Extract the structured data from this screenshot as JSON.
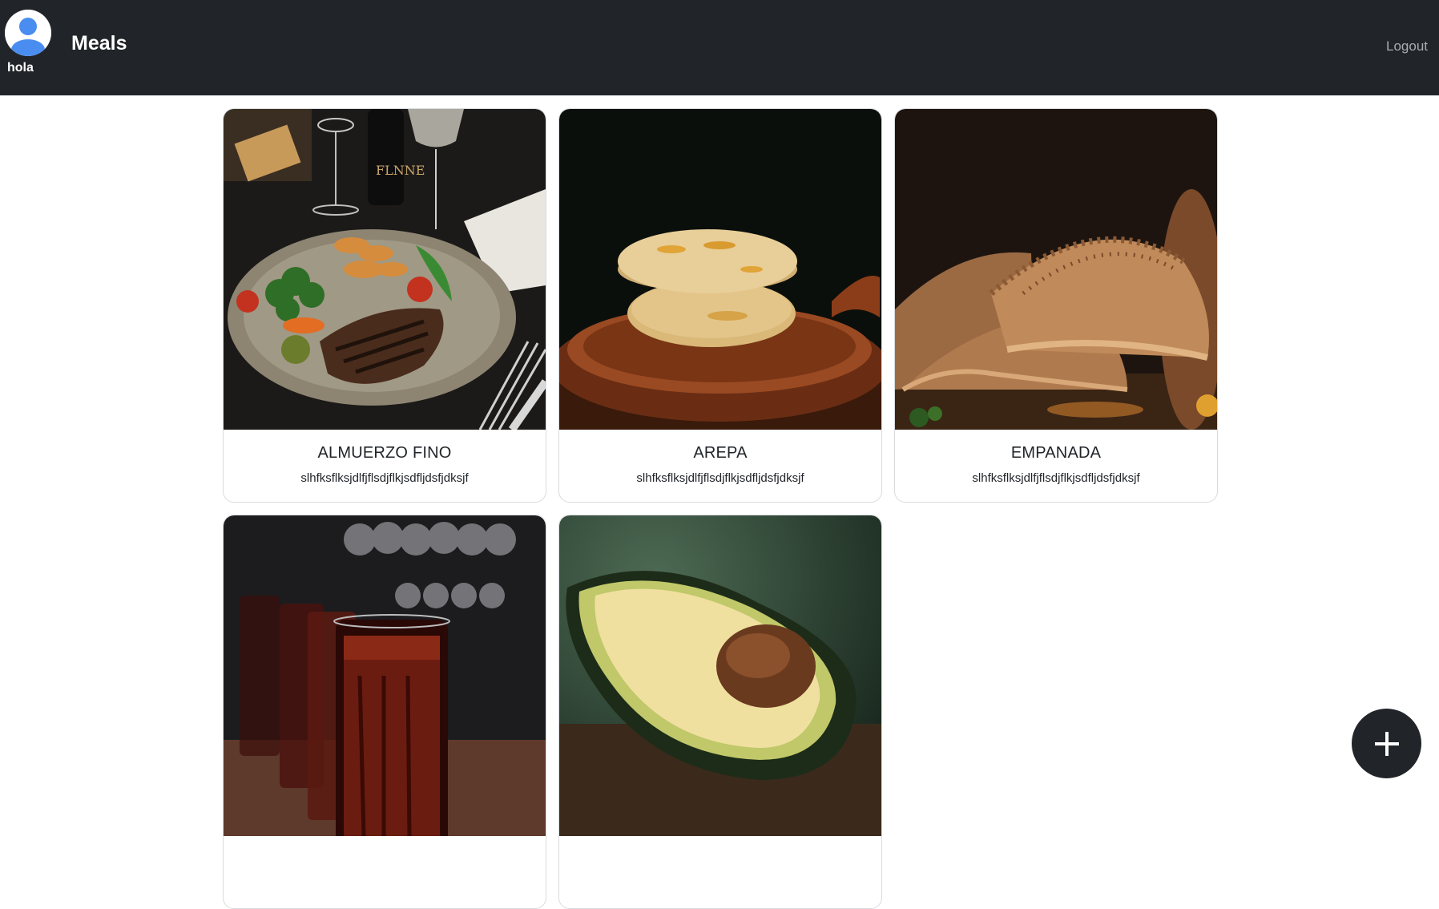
{
  "header": {
    "username": "hola",
    "brand": "Meals",
    "logout_label": "Logout",
    "avatar_icon": "user-avatar-icon"
  },
  "meals": [
    {
      "title": "ALMUERZO FINO",
      "description": "slhfksflksjdlfjflsdjflkjsdfljdsfjdksjf",
      "image": "steak-plate"
    },
    {
      "title": "AREPA",
      "description": "slhfksflksjdlfjflsdjflkjsdfljdsfjdksjf",
      "image": "arepas"
    },
    {
      "title": "EMPANADA",
      "description": "slhfksflksjdlfjflsdjflkjsdfljdsfjdksjf",
      "image": "empanadas"
    },
    {
      "title": "",
      "description": "",
      "image": "cola-glasses"
    },
    {
      "title": "",
      "description": "",
      "image": "avocado"
    }
  ],
  "fab": {
    "icon": "plus-icon"
  },
  "colors": {
    "navbar": "#212529",
    "fab": "#212529",
    "logout": "#a9adb2"
  }
}
